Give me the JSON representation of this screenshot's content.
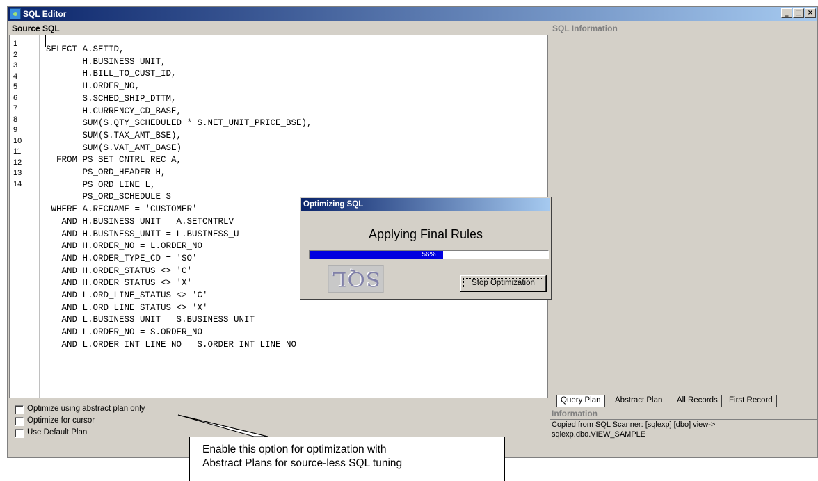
{
  "window": {
    "title": "SQL Editor",
    "minimize_icon": "minimize-icon",
    "restore_icon": "restore-icon",
    "close_icon": "close-icon"
  },
  "source": {
    "header": "Source SQL",
    "line_numbers": [
      "1",
      "2",
      "3",
      "4",
      "5",
      "6",
      "7",
      "8",
      "9",
      "10",
      "11",
      "12",
      "13",
      "14"
    ],
    "code": "SELECT A.SETID,\n       H.BUSINESS_UNIT,\n       H.BILL_TO_CUST_ID,\n       H.ORDER_NO,\n       S.SCHED_SHIP_DTTM,\n       H.CURRENCY_CD_BASE,\n       SUM(S.QTY_SCHEDULED * S.NET_UNIT_PRICE_BSE),\n       SUM(S.TAX_AMT_BSE),\n       SUM(S.VAT_AMT_BASE)\n  FROM PS_SET_CNTRL_REC A,\n       PS_ORD_HEADER H,\n       PS_ORD_LINE L,\n       PS_ORD_SCHEDULE S\n WHERE A.RECNAME = 'CUSTOMER'\n   AND H.BUSINESS_UNIT = A.SETCNTRLV\n   AND H.BUSINESS_UNIT = L.BUSINESS_U\n   AND H.ORDER_NO = L.ORDER_NO\n   AND H.ORDER_TYPE_CD = 'SO'\n   AND H.ORDER_STATUS <> 'C'\n   AND H.ORDER_STATUS <> 'X'\n   AND L.ORD_LINE_STATUS <> 'C'\n   AND L.ORD_LINE_STATUS <> 'X'\n   AND L.BUSINESS_UNIT = S.BUSINESS_UNIT\n   AND L.ORDER_NO = S.ORDER_NO\n   AND L.ORDER_INT_LINE_NO = S.ORDER_INT_LINE_NO"
  },
  "options": [
    {
      "label": "Optimize using abstract plan only",
      "checked": false
    },
    {
      "label": "Optimize for cursor",
      "checked": false
    },
    {
      "label": "Use Default Plan",
      "checked": false
    }
  ],
  "sql_info": {
    "header": "SQL Information"
  },
  "tabs": [
    "Query Plan",
    "Abstract Plan",
    "All Records",
    "First Record"
  ],
  "information": {
    "header": "Information",
    "text": "Copied from SQL Scanner: [sqlexp] [dbo] view->\nsqlexp.dbo.VIEW_SAMPLE"
  },
  "dialog": {
    "title": "Optimizing SQL",
    "status": "Applying Final Rules",
    "progress_label": "56%",
    "progress": 0.56,
    "logo_text": "SQL",
    "stop_button": "Stop Optimization"
  },
  "callout": {
    "text": "Enable this option for optimization with\nAbstract Plans for source-less SQL tuning"
  },
  "colors": {
    "titlebar_start": "#0a246a",
    "titlebar_end": "#a6caf0",
    "progress_fill": "#0000e0",
    "face": "#d4d0c8"
  }
}
